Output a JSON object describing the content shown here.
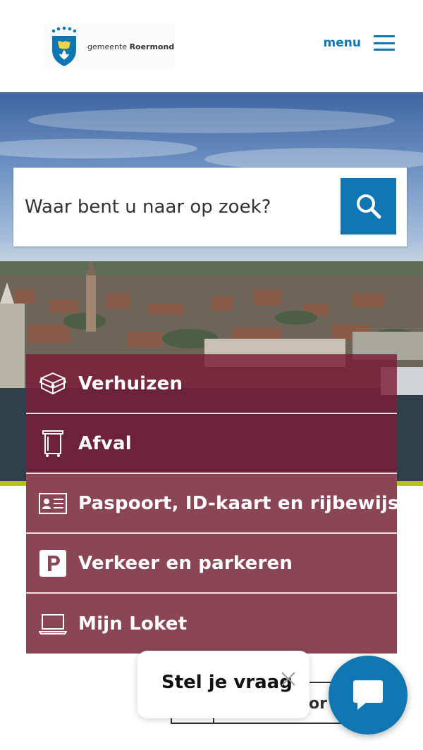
{
  "header": {
    "logo_prefix": "gemeente",
    "logo_name": "Roermond",
    "menu_label": "menu"
  },
  "search": {
    "placeholder": "Waar bent u naar op zoek?",
    "button_icon": "search-icon"
  },
  "tiles": [
    {
      "label": "Verhuizen",
      "icon": "moving-box-icon"
    },
    {
      "label": "Afval",
      "icon": "waste-bin-icon"
    },
    {
      "label": "Paspoort, ID-kaart en rijbewijs",
      "icon": "id-card-icon"
    },
    {
      "label": "Verkeer en parkeren",
      "icon": "parking-icon"
    },
    {
      "label": "Mijn Loket",
      "icon": "laptop-icon"
    }
  ],
  "bottom_button": {
    "partial_label": "oor"
  },
  "chat": {
    "prompt": "Stel je vraag",
    "close_icon": "close-icon",
    "launcher_icon": "chat-icon"
  },
  "colors": {
    "brand_blue": "#0f76b1",
    "tile_maroon": "#7a1c38",
    "accent_green": "#b4c21a"
  }
}
